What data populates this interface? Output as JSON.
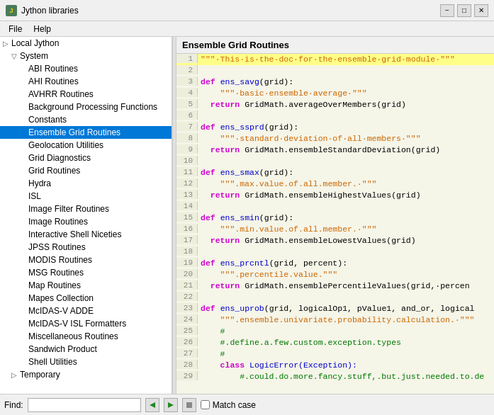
{
  "titleBar": {
    "icon": "J",
    "title": "Jython libraries",
    "controls": [
      "−",
      "□",
      "✕"
    ]
  },
  "menuBar": {
    "items": [
      "File",
      "Help"
    ]
  },
  "sidebar": {
    "nodes": [
      {
        "id": "local-jython",
        "label": "Local Jython",
        "level": 0,
        "icon": "▷",
        "expanded": true
      },
      {
        "id": "system",
        "label": "System",
        "level": 1,
        "icon": "▽",
        "expanded": true
      },
      {
        "id": "abi-routines",
        "label": "ABI Routines",
        "level": 2,
        "icon": ""
      },
      {
        "id": "ahi-routines",
        "label": "AHI Routines",
        "level": 2,
        "icon": ""
      },
      {
        "id": "avhrr-routines",
        "label": "AVHRR Routines",
        "level": 2,
        "icon": ""
      },
      {
        "id": "background-processing",
        "label": "Background Processing Functions",
        "level": 2,
        "icon": ""
      },
      {
        "id": "constants",
        "label": "Constants",
        "level": 2,
        "icon": ""
      },
      {
        "id": "ensemble-grid-routines",
        "label": "Ensemble Grid Routines",
        "level": 2,
        "icon": "",
        "selected": true
      },
      {
        "id": "geolocation-utilities",
        "label": "Geolocation Utilities",
        "level": 2,
        "icon": ""
      },
      {
        "id": "grid-diagnostics",
        "label": "Grid Diagnostics",
        "level": 2,
        "icon": ""
      },
      {
        "id": "grid-routines",
        "label": "Grid Routines",
        "level": 2,
        "icon": ""
      },
      {
        "id": "hydra",
        "label": "Hydra",
        "level": 2,
        "icon": ""
      },
      {
        "id": "isl",
        "label": "ISL",
        "level": 2,
        "icon": ""
      },
      {
        "id": "image-filter-routines",
        "label": "Image Filter Routines",
        "level": 2,
        "icon": ""
      },
      {
        "id": "image-routines",
        "label": "Image Routines",
        "level": 2,
        "icon": ""
      },
      {
        "id": "interactive-shell-niceties",
        "label": "Interactive Shell Niceties",
        "level": 2,
        "icon": ""
      },
      {
        "id": "jpss-routines",
        "label": "JPSS Routines",
        "level": 2,
        "icon": ""
      },
      {
        "id": "modis-routines",
        "label": "MODIS Routines",
        "level": 2,
        "icon": ""
      },
      {
        "id": "msg-routines",
        "label": "MSG Routines",
        "level": 2,
        "icon": ""
      },
      {
        "id": "map-routines",
        "label": "Map Routines",
        "level": 2,
        "icon": ""
      },
      {
        "id": "mapes-collection",
        "label": "Mapes Collection",
        "level": 2,
        "icon": ""
      },
      {
        "id": "mcidas-adde",
        "label": "McIDAS-V ADDE",
        "level": 2,
        "icon": ""
      },
      {
        "id": "mcidas-isl-formatters",
        "label": "McIDAS-V ISL Formatters",
        "level": 2,
        "icon": ""
      },
      {
        "id": "miscellaneous-routines",
        "label": "Miscellaneous Routines",
        "level": 2,
        "icon": ""
      },
      {
        "id": "sandwich-product",
        "label": "Sandwich Product",
        "level": 2,
        "icon": ""
      },
      {
        "id": "shell-utilities",
        "label": "Shell Utilities",
        "level": 2,
        "icon": ""
      },
      {
        "id": "temporary",
        "label": "Temporary",
        "level": 1,
        "icon": "▷"
      }
    ]
  },
  "codePanel": {
    "title": "Ensemble Grid Routines",
    "lines": [
      {
        "num": 1,
        "content": "\"\"\"·This·is·the·doc·for·the·ensemble·grid·module·\"\"\"",
        "type": "docstr",
        "highlight": true
      },
      {
        "num": 2,
        "content": "",
        "type": "normal"
      },
      {
        "num": 3,
        "content": "def ens_savg(grid):",
        "type": "def"
      },
      {
        "num": 4,
        "content": "    \"\"\"·basic·ensemble·average·\"\"\"",
        "type": "docstr"
      },
      {
        "num": 5,
        "content": "  return GridMath.averageOverMembers(grid)",
        "type": "normal"
      },
      {
        "num": 6,
        "content": "",
        "type": "normal"
      },
      {
        "num": 7,
        "content": "def ens_ssprd(grid):",
        "type": "def"
      },
      {
        "num": 8,
        "content": "    \"\"\"·standard·deviation·of·all·members·\"\"\"",
        "type": "docstr"
      },
      {
        "num": 9,
        "content": "  return GridMath.ensembleStandardDeviation(grid)",
        "type": "normal"
      },
      {
        "num": 10,
        "content": "",
        "type": "normal"
      },
      {
        "num": 11,
        "content": "def ens_smax(grid):",
        "type": "def"
      },
      {
        "num": 12,
        "content": "    \"\"\".max.value.of.all.member.·\"\"\"",
        "type": "docstr"
      },
      {
        "num": 13,
        "content": "  return GridMath.ensembleHighestValues(grid)",
        "type": "normal"
      },
      {
        "num": 14,
        "content": "",
        "type": "normal"
      },
      {
        "num": 15,
        "content": "def ens_smin(grid):",
        "type": "def"
      },
      {
        "num": 16,
        "content": "    \"\"\".min.value.of.all.member.·\"\"\"",
        "type": "docstr"
      },
      {
        "num": 17,
        "content": "  return GridMath.ensembleLowestValues(grid)",
        "type": "normal"
      },
      {
        "num": 18,
        "content": "",
        "type": "normal"
      },
      {
        "num": 19,
        "content": "def ens_prcntl(grid, percent):",
        "type": "def"
      },
      {
        "num": 20,
        "content": "    \"\"\".percentile.value.\"\"\"",
        "type": "docstr"
      },
      {
        "num": 21,
        "content": "  return GridMath.ensemblePercentileValues(grid,·percen",
        "type": "normal"
      },
      {
        "num": 22,
        "content": "",
        "type": "normal"
      },
      {
        "num": 23,
        "content": "def ens_uprob(grid, logicalOp1, pValue1, and_or, logical",
        "type": "def"
      },
      {
        "num": 24,
        "content": "    \"\"\".ensemble.univariate.probability.calculation.·\"\"\"",
        "type": "docstr"
      },
      {
        "num": 25,
        "content": "    #",
        "type": "comment"
      },
      {
        "num": 26,
        "content": "    #.define.a.few.custom.exception.types",
        "type": "comment"
      },
      {
        "num": 27,
        "content": "    #",
        "type": "comment"
      },
      {
        "num": 28,
        "content": "    class LogicError(Exception):",
        "type": "class"
      },
      {
        "num": 29,
        "content": "        #.could.do.more.fancy.stuff,.but.just.needed.to.de",
        "type": "comment"
      }
    ]
  },
  "bottomBar": {
    "findLabel": "Find:",
    "findPlaceholder": "",
    "findValue": "",
    "matchCaseLabel": "Match case",
    "buttons": {
      "findPrev": "◀",
      "findNext": "▶",
      "findAll": "⬛"
    }
  }
}
